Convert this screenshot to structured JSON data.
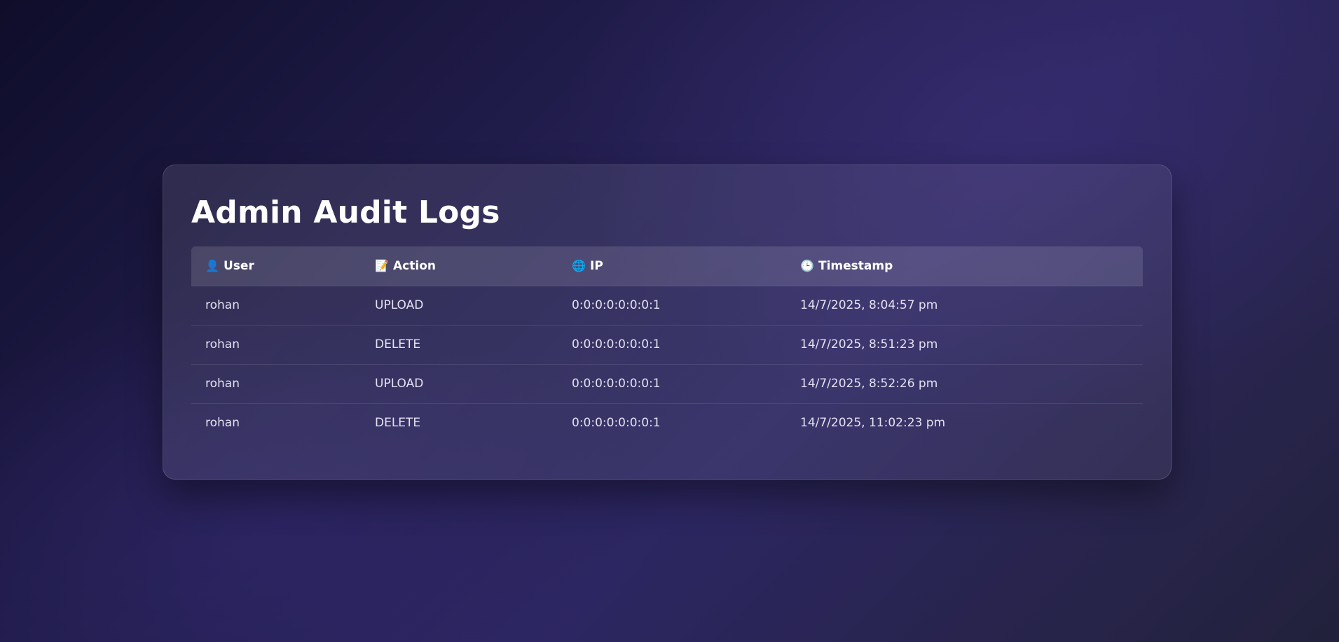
{
  "page": {
    "title": "Admin Audit Logs"
  },
  "table": {
    "columns": [
      {
        "label": "User",
        "icon": "👤"
      },
      {
        "label": "Action",
        "icon": "📝"
      },
      {
        "label": "IP",
        "icon": "🌐"
      },
      {
        "label": "Timestamp",
        "icon": "🕒"
      }
    ],
    "rows": [
      {
        "user": "rohan",
        "action": "UPLOAD",
        "ip": "0:0:0:0:0:0:0:1",
        "timestamp": "14/7/2025, 8:04:57 pm"
      },
      {
        "user": "rohan",
        "action": "DELETE",
        "ip": "0:0:0:0:0:0:0:1",
        "timestamp": "14/7/2025, 8:51:23 pm"
      },
      {
        "user": "rohan",
        "action": "UPLOAD",
        "ip": "0:0:0:0:0:0:0:1",
        "timestamp": "14/7/2025, 8:52:26 pm"
      },
      {
        "user": "rohan",
        "action": "DELETE",
        "ip": "0:0:0:0:0:0:0:1",
        "timestamp": "14/7/2025, 11:02:23 pm"
      }
    ]
  },
  "icons": {
    "user": "user-icon",
    "action": "memo-icon",
    "ip": "globe-icon",
    "timestamp": "clock-icon"
  },
  "colors": {
    "background_dark": "#0f0d2a",
    "background_mid": "#2c2661",
    "text": "#ffffff"
  }
}
